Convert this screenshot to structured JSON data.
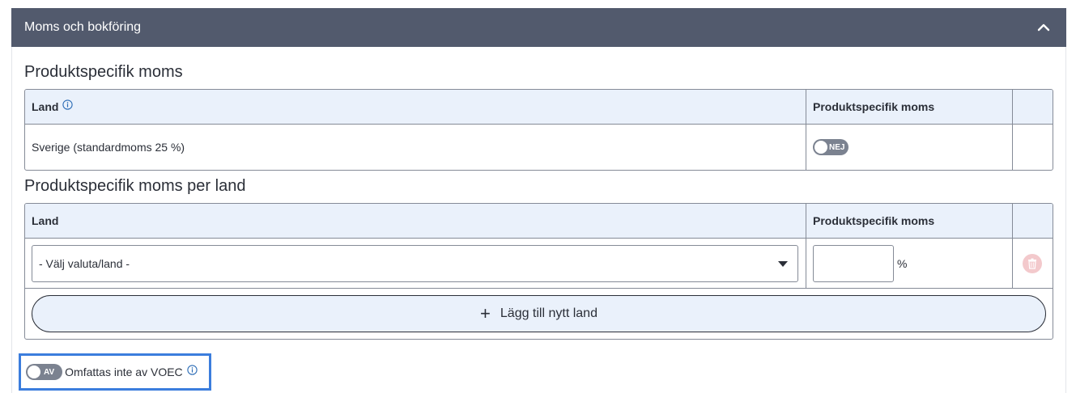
{
  "panel": {
    "title": "Moms och bokföring",
    "collapse_icon": "chevron-up-icon"
  },
  "product_vat": {
    "title": "Produktspecifik moms",
    "columns": {
      "country": "Land",
      "vat": "Produktspecifik moms"
    },
    "row": {
      "country": "Sverige (standardmoms 25 %)",
      "toggle_label": "NEJ"
    }
  },
  "vat_per_country": {
    "title": "Produktspecifik moms per land",
    "columns": {
      "country": "Land",
      "vat": "Produktspecifik moms"
    },
    "row": {
      "select_value": "- Välj valuta/land -",
      "percent_value": "",
      "percent_sign": "%"
    },
    "add_button_label": "Lägg till nytt land"
  },
  "voec": {
    "toggle_label": "AV",
    "label": "Omfattas inte av VOEC"
  },
  "colors": {
    "header_bg": "#525a6d",
    "table_head_bg": "#eaf1fb",
    "focus_outline": "#3b7ddd",
    "info_icon": "#2a6bb5"
  }
}
